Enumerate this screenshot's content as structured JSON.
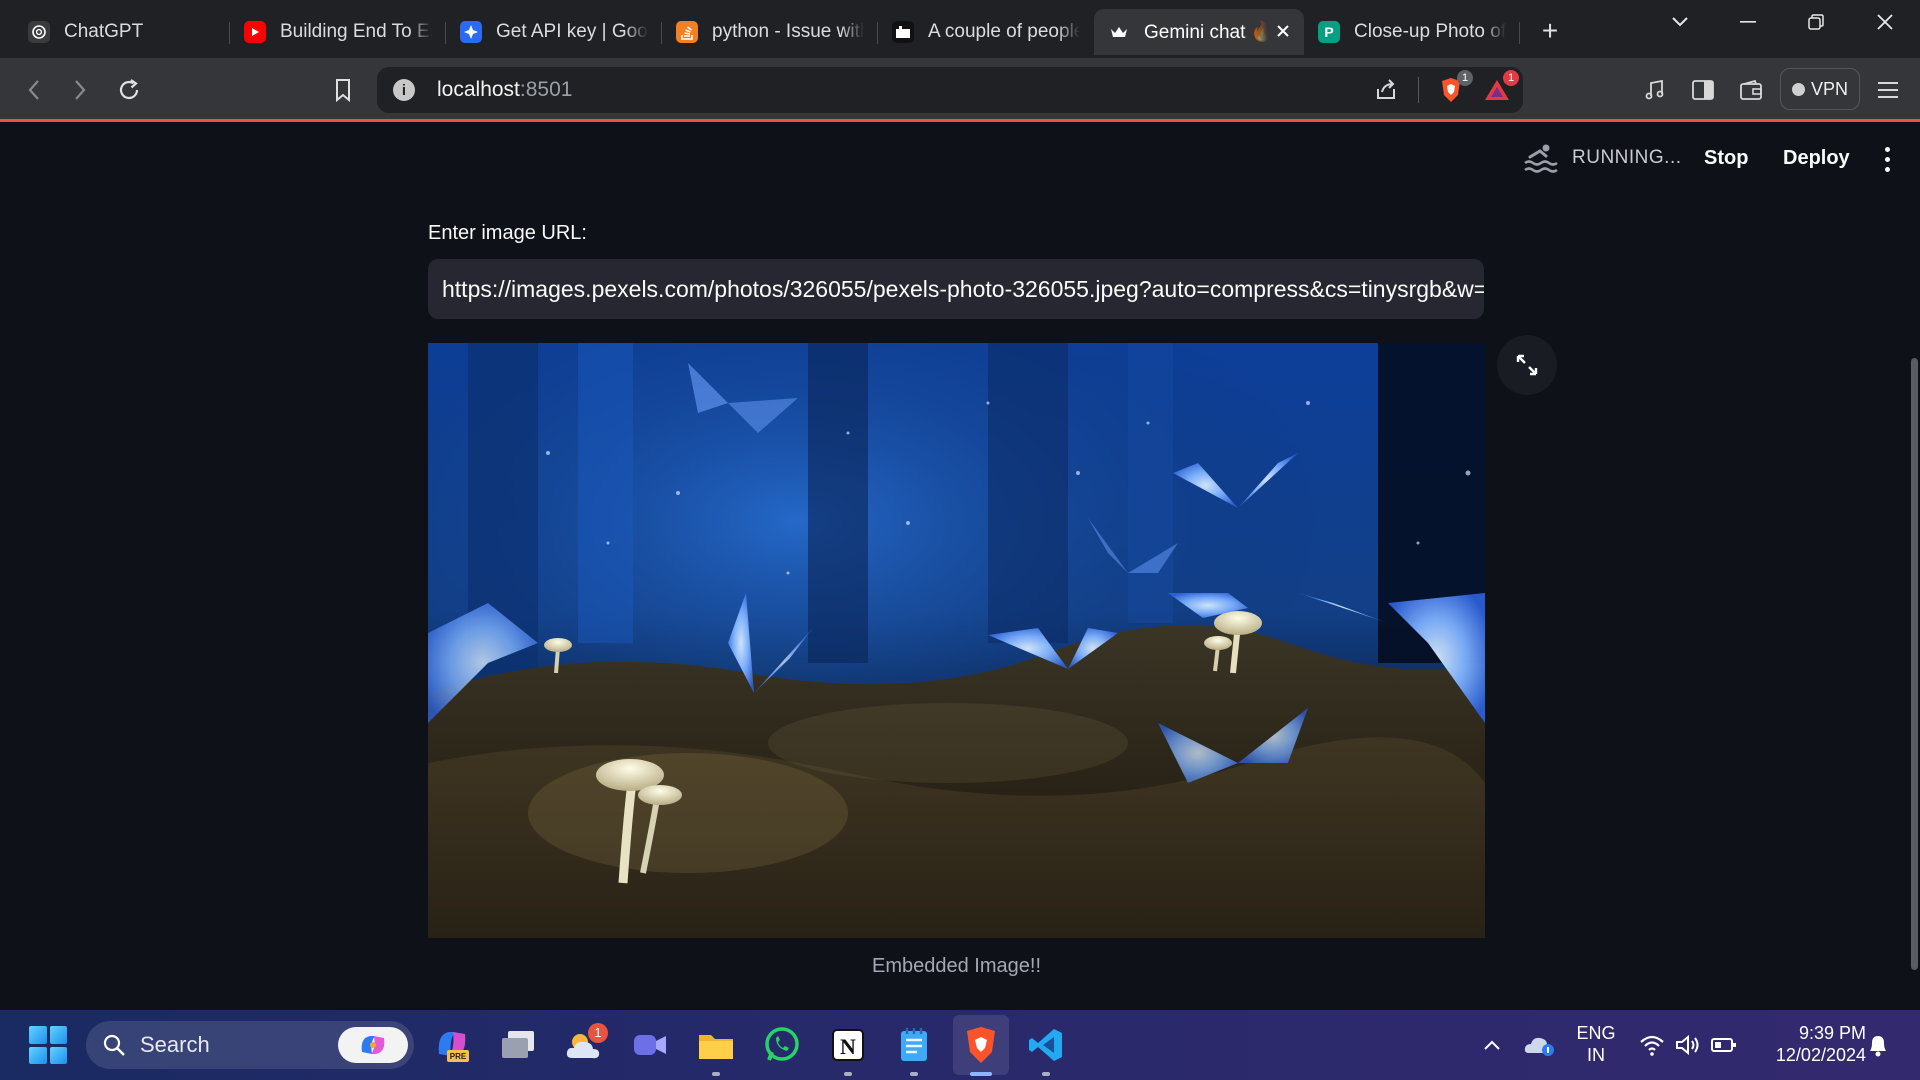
{
  "browser": {
    "tabs": [
      {
        "title": "ChatGPT",
        "icon": "chatgpt-icon",
        "color": "#3a3b3f"
      },
      {
        "title": "Building End To En",
        "icon": "youtube-icon",
        "color": "#ff0000"
      },
      {
        "title": "Get API key | Goog",
        "icon": "google-ai-icon",
        "color": "#2b6bf3"
      },
      {
        "title": "python - Issue with",
        "icon": "stackoverflow-icon",
        "color": "#f48024"
      },
      {
        "title": "A couple of people",
        "icon": "pexels-dark-icon",
        "color": "#111111"
      },
      {
        "title": "Gemini chat 🔥",
        "icon": "streamlit-crown-icon",
        "color": "#35363a",
        "active": true
      },
      {
        "title": "Close-up Photo of",
        "icon": "pexels-icon",
        "color": "#05a081"
      }
    ],
    "new_tab_symbol": "+",
    "address": {
      "host": "localhost",
      "port": ":8501"
    },
    "brave_badge": "1",
    "rewards_badge": "1",
    "vpn_label": "VPN"
  },
  "app": {
    "status": "RUNNING...",
    "stop_label": "Stop",
    "deploy_label": "Deploy",
    "input_label": "Enter image URL:",
    "input_value": "https://images.pexels.com/photos/326055/pexels-photo-326055.jpeg?auto=compress&cs=tinysrgb&w=",
    "caption": "Embedded Image!!"
  },
  "taskbar": {
    "search_placeholder": "Search",
    "weather_badge": "1",
    "lang_top": "ENG",
    "lang_bottom": "IN",
    "time": "9:39 PM",
    "date": "12/02/2024"
  },
  "colors": {
    "app_bg": "#0e1117",
    "input_bg": "#262730",
    "browser_chrome": "#35363a",
    "accent_line": "#e8553c"
  }
}
